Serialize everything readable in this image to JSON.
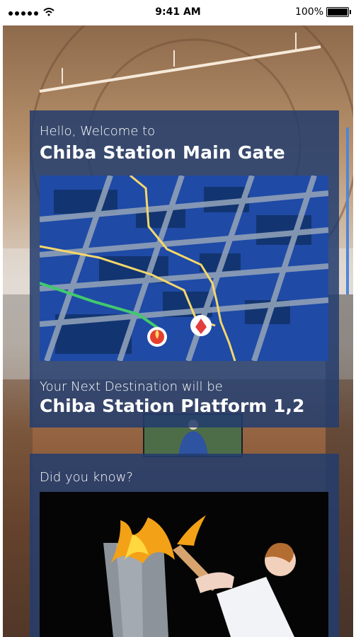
{
  "status_bar": {
    "time": "9:41 AM",
    "battery_text": "100%",
    "icons": [
      "signal-dots-icon",
      "wifi-icon",
      "battery-icon"
    ]
  },
  "welcome_card": {
    "greeting": "Hello, Welcome to",
    "location": "Chiba Station Main Gate",
    "next_label": "Your Next Destination will be",
    "destination": "Chiba Station Platform 1,2",
    "map_icons": [
      "torch-map-pin-icon",
      "location-pin-icon"
    ]
  },
  "fact_card": {
    "label": "Did you know?"
  },
  "colors": {
    "card_bg": "#233C6E",
    "map_bg": "#1F4AA6",
    "route_yellow": "#F5D76A",
    "route_green": "#42C96E",
    "pin_red": "#E23E3E"
  }
}
